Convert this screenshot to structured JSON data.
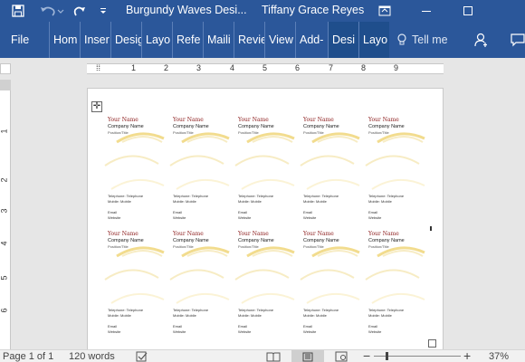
{
  "titlebar": {
    "document_title": "Burgundy Waves Desi...",
    "user_name": "Tiffany Grace Reyes",
    "quick_access_icons": [
      "save-icon",
      "undo-icon",
      "redo-icon",
      "customize-icon"
    ],
    "window_icons": [
      "ribbon-display-icon",
      "minimize-icon",
      "maximize-icon"
    ]
  },
  "tabs": [
    "File",
    "Hom",
    "Inser",
    "Desig",
    "Layo",
    "Refe",
    "Maili",
    "Revie",
    "View",
    "Add-",
    "Desi",
    "Layo"
  ],
  "tell_me": "Tell me",
  "ruler": {
    "marks": [
      "1",
      "2",
      "3",
      "4",
      "5",
      "6",
      "7",
      "8",
      "9"
    ],
    "vertical_marks": [
      "1",
      "2",
      "3",
      "4",
      "5",
      "6"
    ]
  },
  "card": {
    "name": "Your Name",
    "company": "Company Name",
    "position": "Position/Title",
    "telephone": "Telephone: Telephone",
    "mobile": "Mobile: Mobile",
    "email": "Email",
    "website": "Website"
  },
  "status": {
    "page": "Page 1 of 1",
    "words": "120 words",
    "zoom": "37%"
  },
  "colors": {
    "ribbon": "#2b579a",
    "name_text": "#8b1a1a",
    "wave": "#f2dc8e"
  }
}
